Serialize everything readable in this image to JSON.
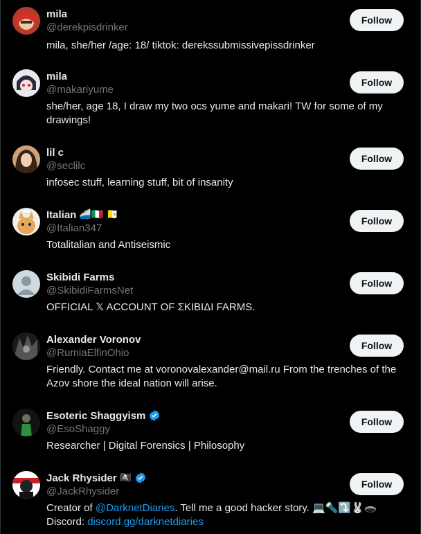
{
  "follow_label": "Follow",
  "accent_color": "#1d9bf0",
  "users": [
    {
      "name": "mila",
      "handle": "@derekpisdrinker",
      "bio": "mila, she/her /age: 18/ tiktok: derekssubmissivepissdrinker",
      "avatar": "red-hair-character-avatar"
    },
    {
      "name": "mila",
      "handle": "@makariyume",
      "bio": "she/her, age 18, I draw my two ocs yume and makari! TW for some of my drawings!",
      "avatar": "anime-character-avatar"
    },
    {
      "name": "lil c",
      "handle": "@seclilc",
      "bio": "infosec stuff, learning stuff, bit of insanity",
      "avatar": "photo-avatar"
    },
    {
      "name": "Italian",
      "name_emoji": "🚄🇮🇹 🇻🇦",
      "handle": "@Italian347",
      "bio": "Totalitalian and Antiseismic",
      "avatar": "cat-avatar"
    },
    {
      "name": "Skibidi Farms",
      "handle": "@SkibidiFarmsNet",
      "bio": "OFFICIAL 𝕏 ACCOUNT OF ΣKIBIΔI FARMS.",
      "avatar": "default-profile-avatar"
    },
    {
      "name": "Alexander Voronov",
      "handle": "@RumiaElfinOhio",
      "bio": "Friendly. Contact me at voronovalexander@mail.ru From the trenches of the Azov shore the ideal nation will arise.",
      "avatar": "dark-art-avatar"
    },
    {
      "name": "Esoteric Shaggyism",
      "verified": true,
      "handle": "@EsoShaggy",
      "bio": "Researcher | Digital Forensics | Philosophy",
      "avatar": "green-figure-avatar"
    },
    {
      "name": "Jack Rhysider",
      "name_emoji": "🏴‍☠️",
      "verified": true,
      "handle": "@JackRhysider",
      "bio_prefix": "Creator of ",
      "bio_link": "@DarknetDiaries",
      "bio_middle": ". Tell me a good hacker story. 💻🔦⤵️🐰🕳️",
      "bio_line2_prefix": "Discord: ",
      "bio_link2": "discord.gg/darknetdiaries",
      "avatar": "masked-man-avatar"
    }
  ]
}
